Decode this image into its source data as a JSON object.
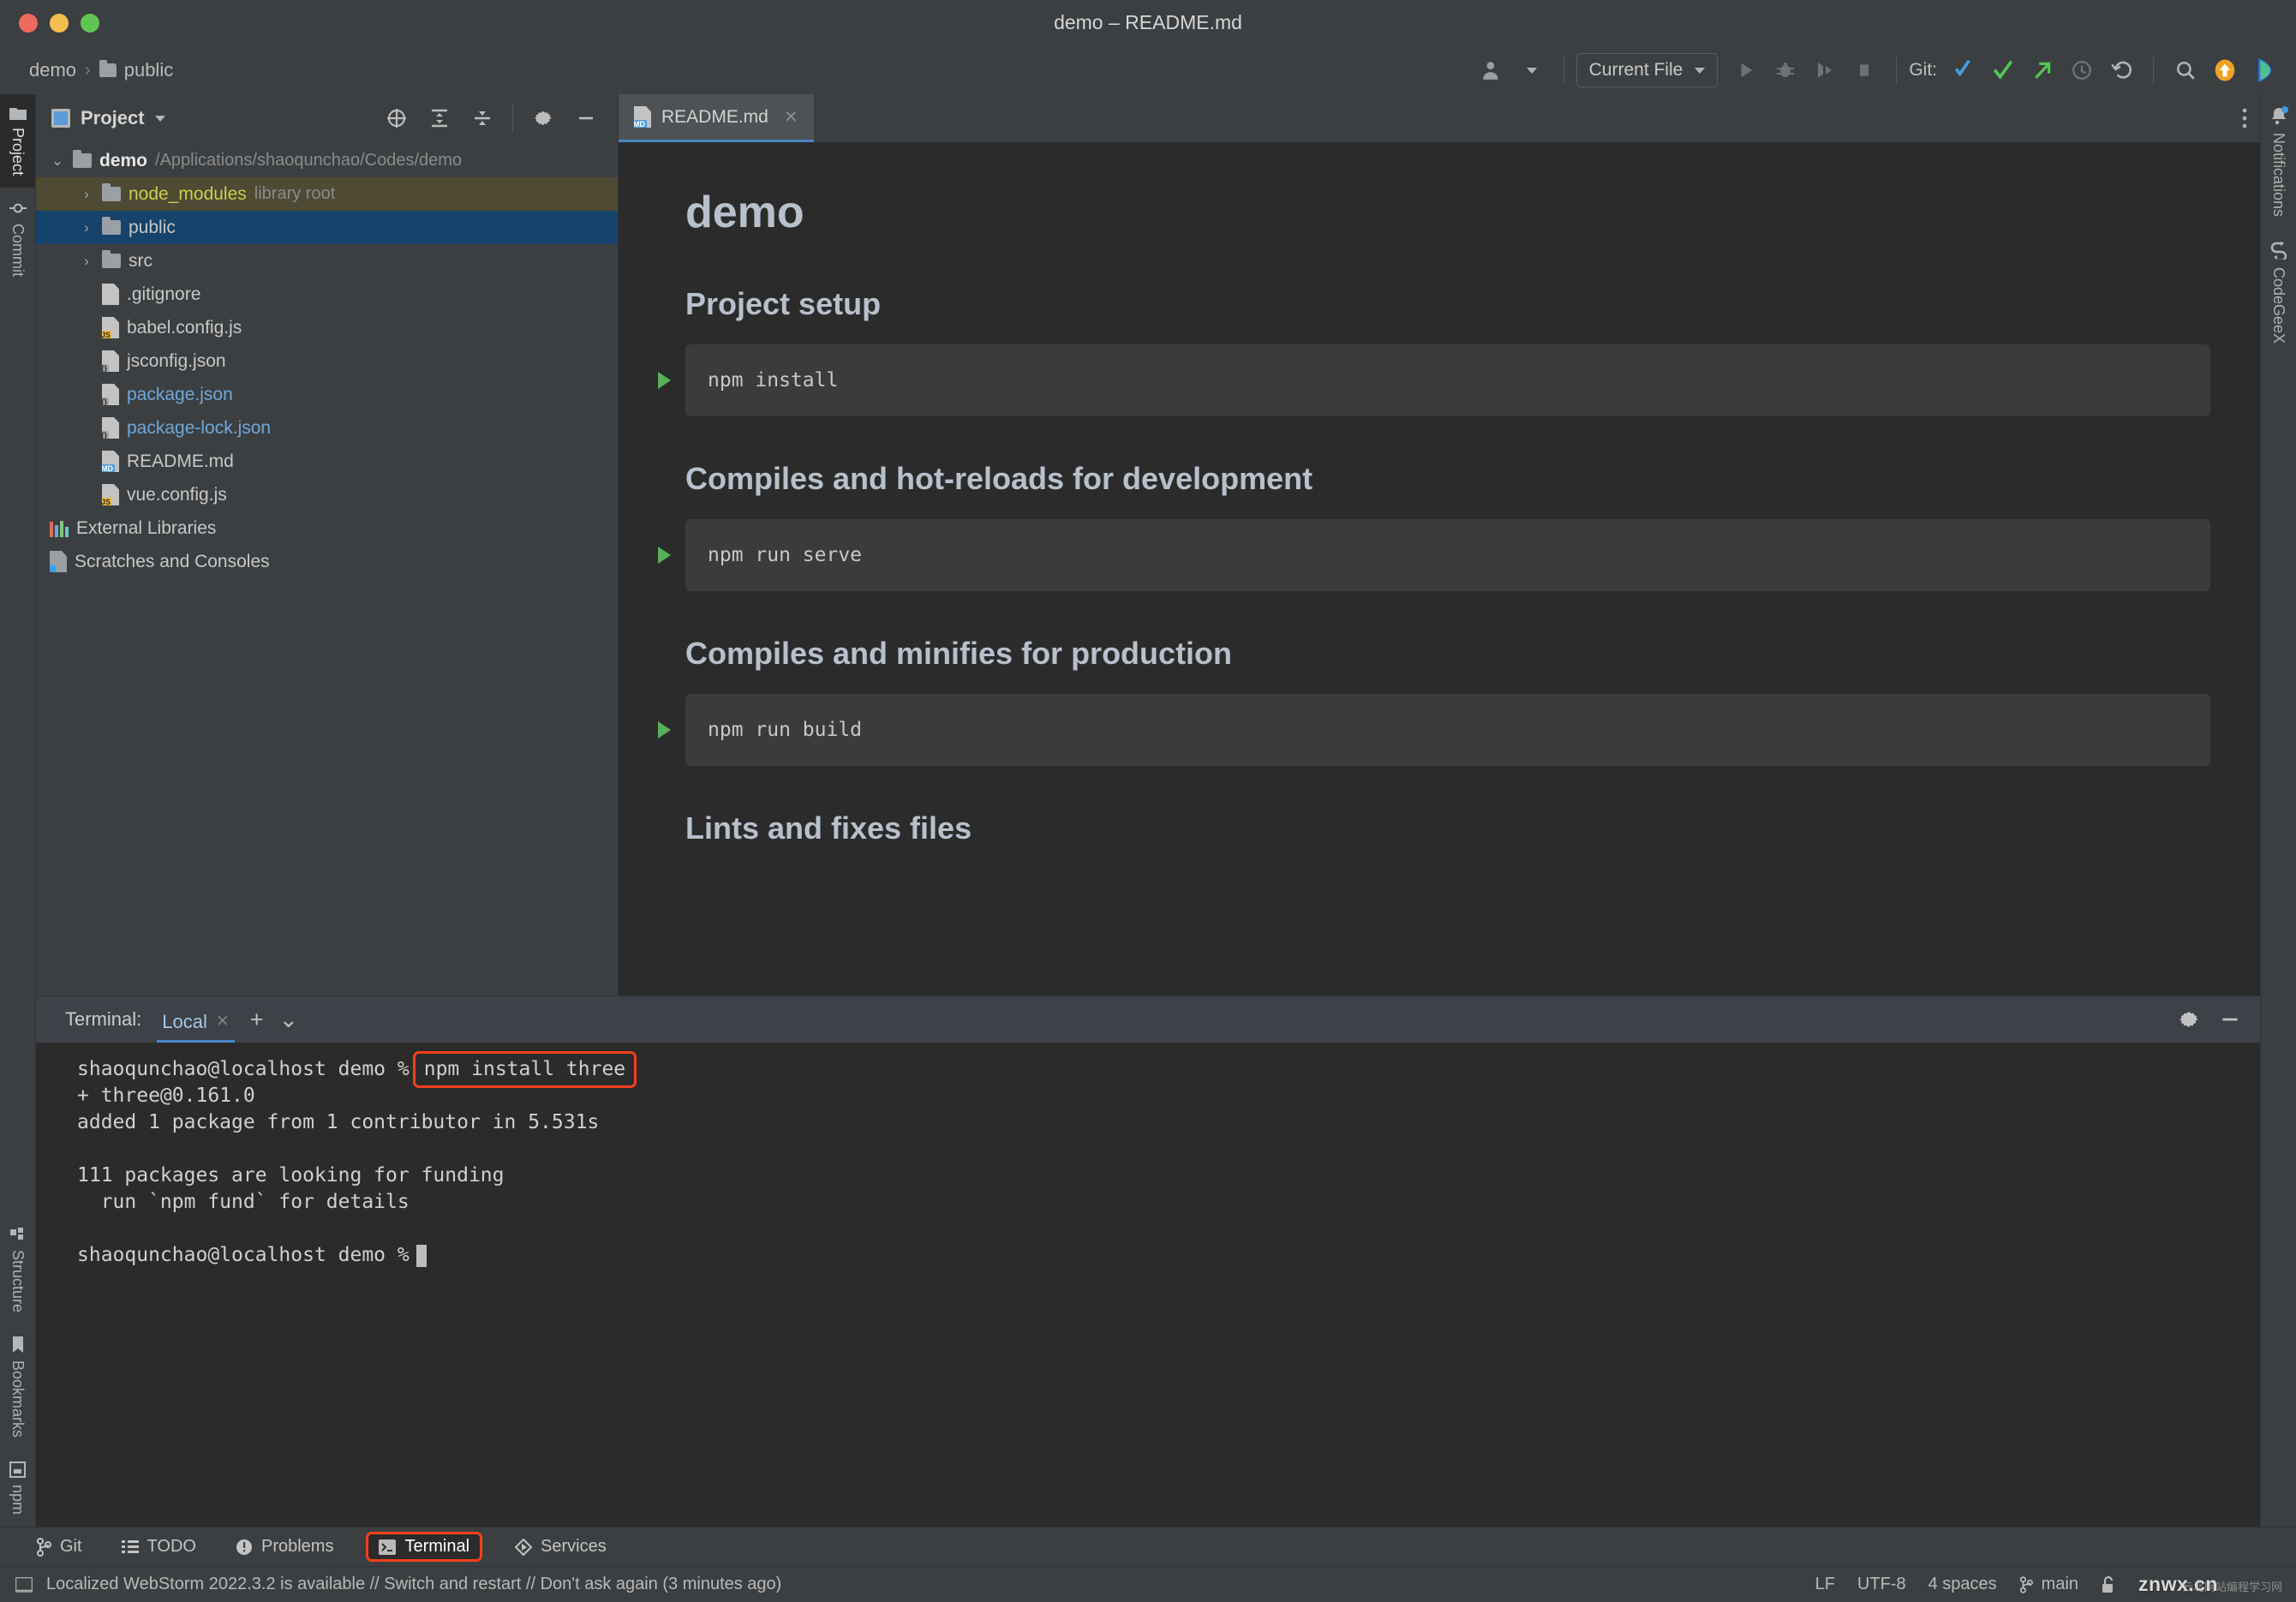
{
  "window": {
    "title": "demo – README.md",
    "traffic_lights": [
      "close",
      "minimize",
      "zoom"
    ]
  },
  "breadcrumb": {
    "items": [
      "demo",
      "public"
    ],
    "separator": "›"
  },
  "toolbar": {
    "run_config_label": "Current File",
    "git_label": "Git:",
    "icons": [
      "user-avatar-icon",
      "run-icon",
      "debug-icon",
      "coverage-icon",
      "stop-icon",
      "git-update-icon",
      "git-commit-icon",
      "git-push-icon",
      "history-icon",
      "rollback-icon",
      "search-everywhere-icon",
      "updates-icon",
      "codegeex-icon"
    ]
  },
  "left_strip": {
    "top": [
      {
        "label": "Project",
        "icon": "project-folder-icon",
        "active": true
      },
      {
        "label": "Commit",
        "icon": "commit-icon",
        "active": false
      }
    ],
    "bottom": [
      {
        "label": "Structure",
        "icon": "structure-icon"
      },
      {
        "label": "Bookmarks",
        "icon": "bookmark-icon"
      },
      {
        "label": "npm",
        "icon": "npm-icon"
      }
    ]
  },
  "right_strip": [
    {
      "label": "Notifications",
      "icon": "bell-icon",
      "badge": true
    },
    {
      "label": "CodeGeeX",
      "icon": "codegeex-icon",
      "badge": false
    }
  ],
  "project_panel": {
    "title": "Project",
    "tools": [
      "locate-icon",
      "expand-all-icon",
      "collapse-all-icon",
      "settings-gear-icon",
      "hide-icon"
    ],
    "tree": [
      {
        "depth": 0,
        "arrow": "⌄",
        "icon": "folder",
        "name": "demo",
        "bold": true,
        "note": "/Applications/shaoqunchao/Codes/demo",
        "state": "root"
      },
      {
        "depth": 1,
        "arrow": "›",
        "icon": "folder",
        "name": "node_modules",
        "color": "yellow",
        "note": "library root",
        "state": "library"
      },
      {
        "depth": 1,
        "arrow": "›",
        "icon": "folder",
        "name": "public",
        "state": "selected"
      },
      {
        "depth": 1,
        "arrow": "›",
        "icon": "folder",
        "name": "src",
        "state": "normal"
      },
      {
        "depth": 1,
        "arrow": "",
        "icon": "file-git",
        "name": ".gitignore",
        "state": "normal"
      },
      {
        "depth": 1,
        "arrow": "",
        "icon": "file-js",
        "name": "babel.config.js",
        "state": "normal"
      },
      {
        "depth": 1,
        "arrow": "",
        "icon": "file-json",
        "name": "jsconfig.json",
        "state": "normal"
      },
      {
        "depth": 1,
        "arrow": "",
        "icon": "file-json",
        "name": "package.json",
        "color": "blue",
        "state": "normal"
      },
      {
        "depth": 1,
        "arrow": "",
        "icon": "file-json",
        "name": "package-lock.json",
        "color": "blue",
        "state": "normal"
      },
      {
        "depth": 1,
        "arrow": "",
        "icon": "file-md",
        "name": "README.md",
        "state": "normal"
      },
      {
        "depth": 1,
        "arrow": "",
        "icon": "file-js",
        "name": "vue.config.js",
        "state": "normal"
      },
      {
        "depth": 0,
        "arrow": "",
        "icon": "libraries",
        "name": "External Libraries",
        "state": "normal"
      },
      {
        "depth": 0,
        "arrow": "",
        "icon": "scratches",
        "name": "Scratches and Consoles",
        "state": "normal"
      }
    ]
  },
  "editor": {
    "tab": {
      "label": "README.md",
      "icon": "markdown-file-icon",
      "close": "✕"
    },
    "markdown": {
      "title": "demo",
      "sections": [
        {
          "heading": "Project setup",
          "code": "npm install"
        },
        {
          "heading": "Compiles and hot-reloads for development",
          "code": "npm run serve"
        },
        {
          "heading": "Compiles and minifies for production",
          "code": "npm run build"
        },
        {
          "heading": "Lints and fixes files",
          "code": null
        }
      ]
    }
  },
  "terminal": {
    "label": "Terminal:",
    "tab": "Local",
    "tab_close": "✕",
    "add": "+",
    "dropdown": "⌄",
    "tools": [
      "settings-gear-icon",
      "hide-icon"
    ],
    "prompt": "shaoqunchao@localhost demo %",
    "highlighted_command": "npm install three",
    "lines": [
      "+ three@0.161.0",
      "added 1 package from 1 contributor in 5.531s",
      "",
      "111 packages are looking for funding",
      "  run `npm fund` for details",
      ""
    ],
    "final_prompt": "shaoqunchao@localhost demo %"
  },
  "tool_windows": [
    {
      "label": "Git",
      "icon": "git-branch-icon",
      "active": false
    },
    {
      "label": "TODO",
      "icon": "todo-list-icon",
      "active": false
    },
    {
      "label": "Problems",
      "icon": "problems-icon",
      "active": false
    },
    {
      "label": "Terminal",
      "icon": "terminal-icon",
      "active": true
    },
    {
      "label": "Services",
      "icon": "services-icon",
      "active": false
    }
  ],
  "status_bar": {
    "message": "Localized WebStorm 2022.3.2 is available // Switch and restart // Don't ask again (3 minutes ago)",
    "line_separator": "LF",
    "encoding": "UTF-8",
    "indent": "4 spaces",
    "branch": "main",
    "lock_icon": "unlocked-icon",
    "watermark": "znwx.cn",
    "watermark_sub": "云北网站编程学习网"
  },
  "colors": {
    "accent_blue": "#4a88c7",
    "highlight_red": "#f2401b",
    "selection_blue": "#16436b",
    "library_olive": "#4e4a34",
    "editor_bg": "#2b2b2b",
    "panel_bg": "#3c3f41",
    "run_green": "#5aaf5a"
  }
}
